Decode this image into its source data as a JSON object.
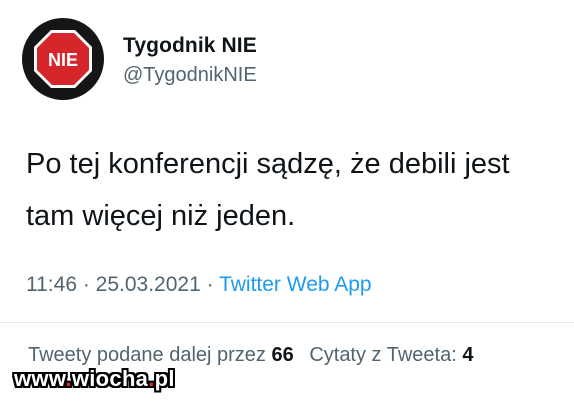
{
  "author": {
    "name": "Tygodnik NIE",
    "handle": "@TygodnikNIE",
    "avatar_text": "NIE",
    "avatar_color": "#d7262b"
  },
  "tweet": {
    "line1": "Po tej konferencji sądzę, że debili jest",
    "line2": "tam więcej niż jeden."
  },
  "meta": {
    "time": "11:46",
    "separator1": " · ",
    "date": "25.03.2021",
    "separator2": " · ",
    "source": "Twitter Web App"
  },
  "stats": {
    "retweets_label": "Tweety podane dalej przez",
    "retweets_count": "66",
    "quotes_label": "Cytaty z Tweeta:",
    "quotes_count": "4"
  },
  "watermark": {
    "part1": "www",
    "dot1": ".",
    "part2": "wiocha",
    "dot2": ".",
    "part3": "pl"
  },
  "colors": {
    "text": "#0f1419",
    "muted": "#536471",
    "link": "#1d9bf0"
  }
}
